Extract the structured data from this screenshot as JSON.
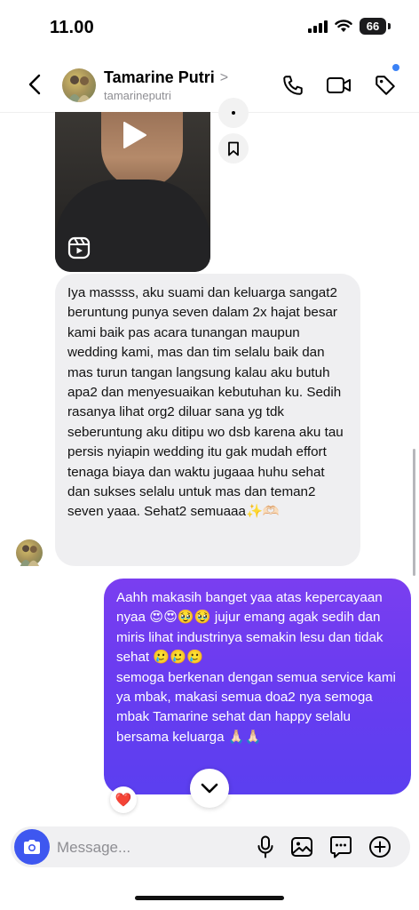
{
  "status_bar": {
    "time": "11.00",
    "battery": "66"
  },
  "header": {
    "name": "Tamarine Putri",
    "chevron": ">",
    "username": "tamarineputri",
    "actions": [
      "phone-icon",
      "video-icon",
      "tag-icon"
    ],
    "accent_dot_color": "#3b82f6"
  },
  "messages": {
    "received_text": "Iya massss, aku suami dan keluarga sangat2 beruntung punya seven dalam 2x hajat besar kami baik pas acara tunangan maupun wedding kami, mas dan tim selalu baik dan mas turun tangan langsung kalau aku butuh apa2 dan menyesuaikan kebutuhan ku. Sedih rasanya lihat org2 diluar sana yg tdk seberuntung aku ditipu wo dsb karena aku tau persis nyiapin wedding itu gak mudah effort tenaga biaya dan waktu jugaaa huhu sehat dan sukses selalu untuk mas dan teman2 seven yaaa. Sehat2 semuaaa✨🫶🏻",
    "sent_text": "Aahh makasih banget yaa atas kepercayaan nyaa 😍😍🥹🥹 jujur emang agak sedih dan miris lihat industrinya semakin lesu dan tidak sehat 🥲🥲🥲\nsemoga berkenan dengan semua service kami ya mbak, makasi semua doa2 nya semoga mbak Tamarine sehat dan happy selalu bersama keluarga 🙏🏻🙏🏻",
    "sent_color": "#6a3cf0",
    "reaction": "❤️"
  },
  "composer": {
    "placeholder": "Message..."
  }
}
